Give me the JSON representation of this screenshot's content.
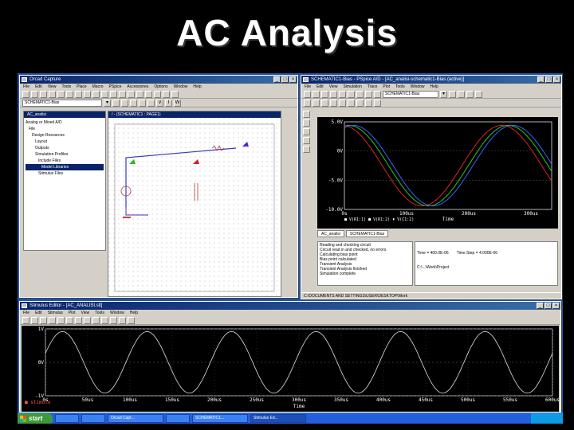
{
  "slide": {
    "title": "AC Analysis"
  },
  "capture": {
    "title": "Orcad Capture",
    "menu": [
      "File",
      "Edit",
      "View",
      "Tools",
      "Place",
      "Macro",
      "PSpice",
      "Accessories",
      "Options",
      "Window",
      "Help"
    ],
    "combo": "SCHEMATIC1-Bias",
    "project": {
      "title": "AC_analisi",
      "items": [
        "Analog or Mixed A/D",
        "File",
        "Design Resources",
        "Layout",
        "Outputs",
        "Simulation Profiles",
        "Include Files",
        "Model Libraries",
        "Stimulus Files"
      ],
      "selected": 7
    },
    "schematic": {
      "title": "/ - (SCHEMATIC1 : PAGE1)"
    }
  },
  "pspice": {
    "title": "SCHEMATIC1-Bias - PSpice A/D - [AC_analisi-schematic1-Bias (active)]",
    "menu": [
      "File",
      "Edit",
      "View",
      "Simulation",
      "Trace",
      "Plot",
      "Tools",
      "Window",
      "Help"
    ],
    "combo": "SCHEMATIC1-Bias",
    "plot": {
      "y_ticks": [
        "5.0V",
        "0V",
        "-5.0V",
        "-10.0V"
      ],
      "x_ticks": [
        "0s",
        "100us",
        "200us",
        "300us"
      ],
      "xlabel": "Time",
      "legend": "■ V(R1:1) ■ V(R1:2) ♦ V(C1:2)"
    },
    "tabs": [
      "AC_analisi",
      "SCHEMATIC1-Bias"
    ],
    "output_lines": [
      "Reading and checking circuit",
      "Circuit read in and checked, no errors",
      "Calculating bias point",
      "Bias point calculated",
      "Transient Analysis",
      "Transient Analysis finished",
      "Simulation complete"
    ],
    "status_right": {
      "time": "Time = 400.0E-06",
      "step": "Time Step = 4.000E-06",
      "path": "C:\\...\\Work\\Project"
    },
    "statusbar": "C:\\DOCUMENTS AND SETTINGS\\USER\\DESKTOP\\Work"
  },
  "stimulus": {
    "title": "Stimulus Editor - [AC_ANALISI.stl]",
    "menu": [
      "File",
      "Edit",
      "Stimulus",
      "Plot",
      "View",
      "Tools",
      "Window",
      "Help"
    ],
    "y_ticks": [
      "1V",
      "0V",
      "-1V"
    ],
    "x_ticks": [
      "0s",
      "50us",
      "100us",
      "150us",
      "200us",
      "250us",
      "300us",
      "350us",
      "400us",
      "450us",
      "500us",
      "550us",
      "600us"
    ],
    "xlabel": "Time",
    "trace": "■ stimulo"
  },
  "taskbar": {
    "start": "start",
    "tasks": [
      "",
      "",
      "Orcad Capt...",
      "",
      "SCHEMATIC1...",
      "Stimulus Ed..."
    ]
  }
}
